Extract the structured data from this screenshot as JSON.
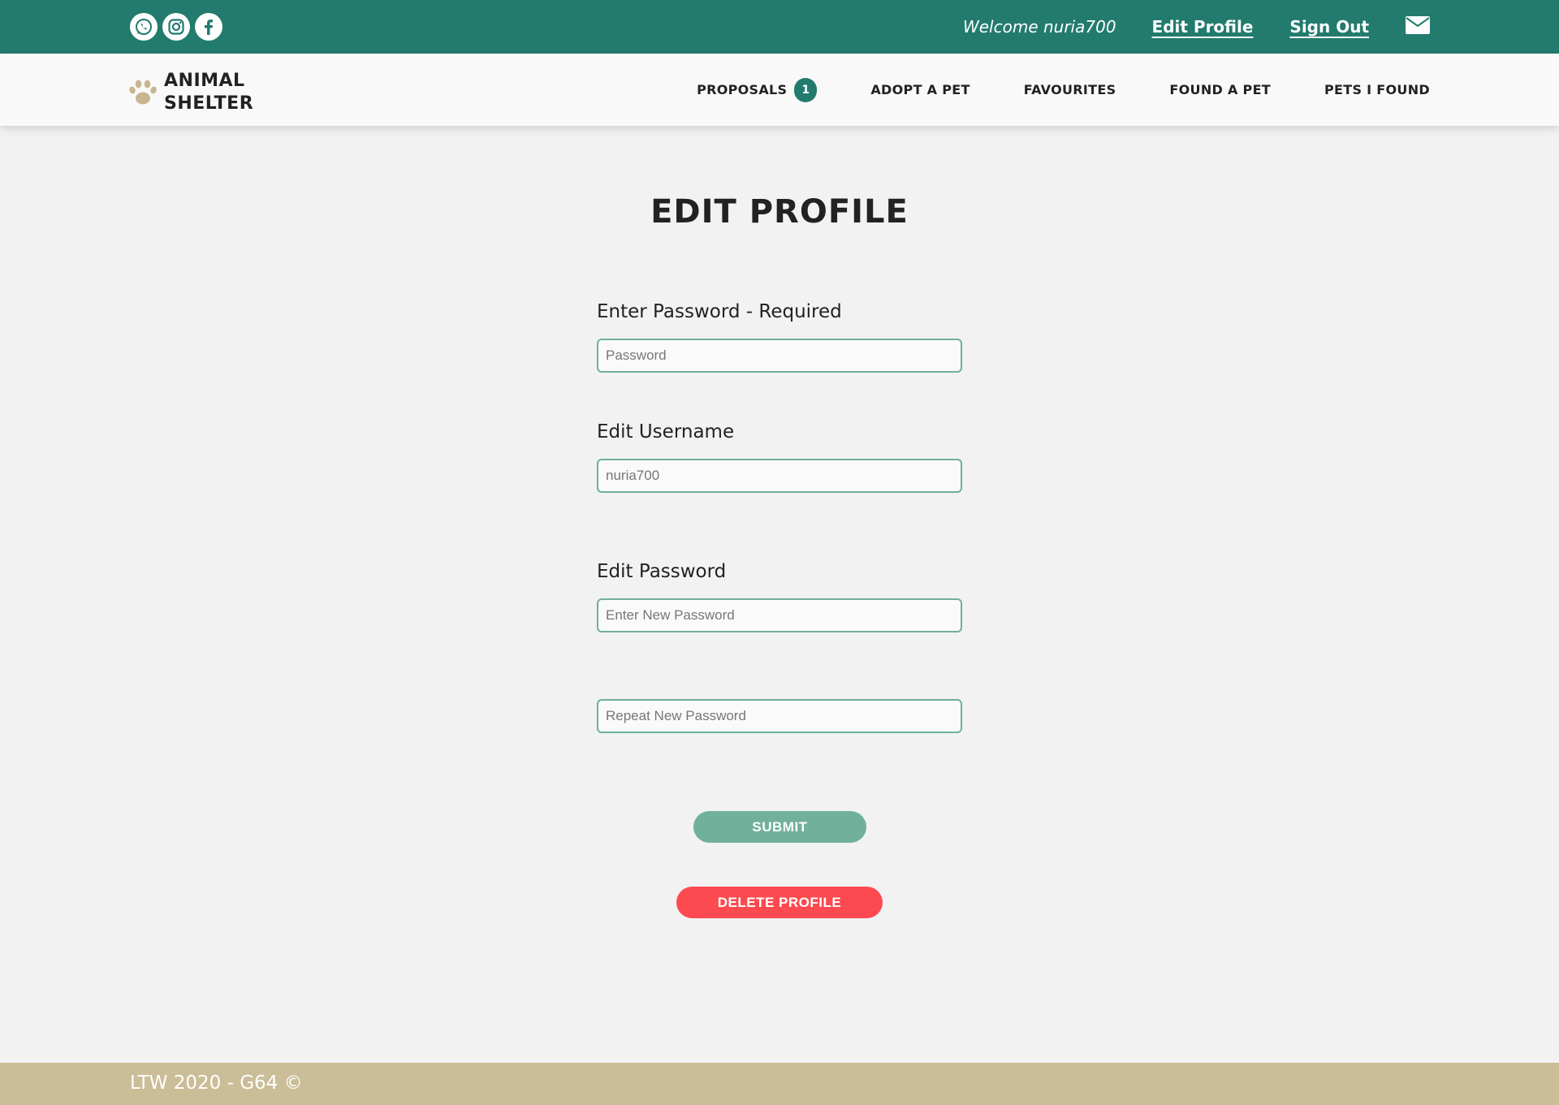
{
  "topbar": {
    "social": [
      "whatsapp-icon",
      "instagram-icon",
      "facebook-icon"
    ],
    "welcome": "Welcome nuria700",
    "edit_profile": "Edit Profile",
    "sign_out": "Sign Out",
    "mail_icon": "mail-icon",
    "bg_color": "#227b6d"
  },
  "nav": {
    "logo_icon": "paw-icon",
    "logo_line1": "ANIMAL",
    "logo_line2": "SHELTER",
    "items": [
      {
        "label": "PROPOSALS",
        "badge": "1"
      },
      {
        "label": "ADOPT A PET"
      },
      {
        "label": "FAVOURITES"
      },
      {
        "label": "FOUND A PET"
      },
      {
        "label": "PETS I FOUND"
      }
    ]
  },
  "main": {
    "title": "EDIT PROFILE",
    "current_password": {
      "label": "Enter Password - Required",
      "placeholder": "Password",
      "value": ""
    },
    "username": {
      "label": "Edit Username",
      "placeholder": "nuria700",
      "value": ""
    },
    "new_password": {
      "label": "Edit Password",
      "placeholder": "Enter New Password",
      "value": ""
    },
    "repeat_password": {
      "placeholder": "Repeat New Password",
      "value": ""
    },
    "submit_label": "SUBMIT",
    "delete_label": "DELETE PROFILE"
  },
  "footer": {
    "text": "LTW 2020 - G64 ©",
    "bg_color": "#cbbd97"
  },
  "colors": {
    "accent": "#227b6d",
    "submit": "#71b09b",
    "delete": "#fc4a50",
    "paw": "#c9b690"
  }
}
